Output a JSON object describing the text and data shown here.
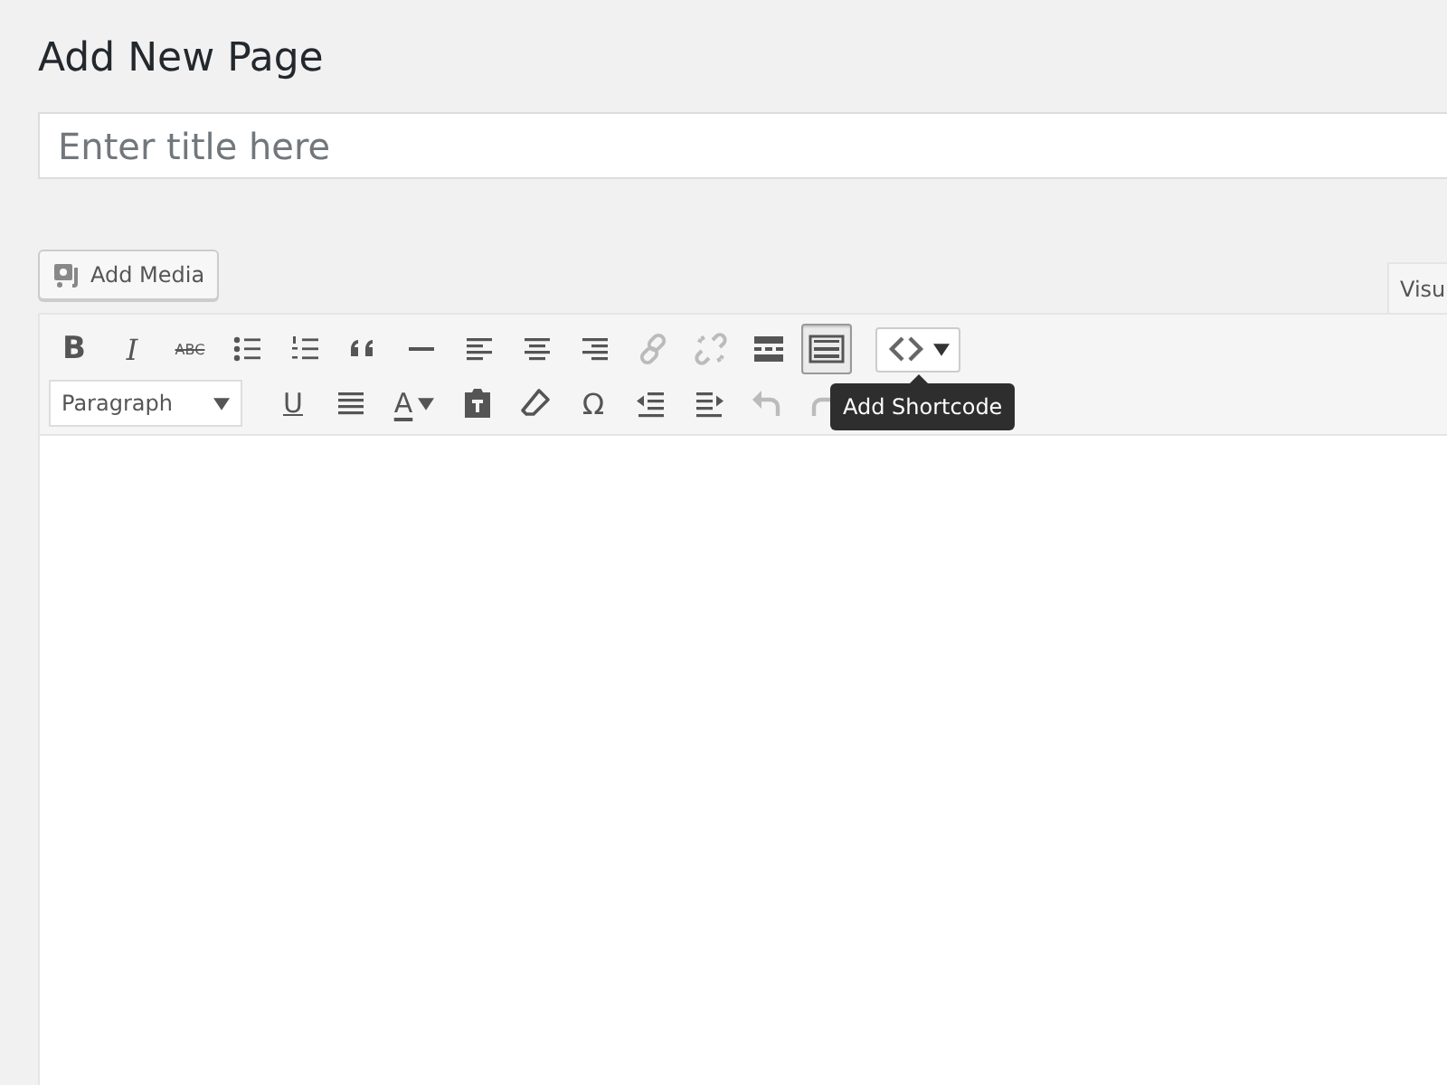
{
  "heading": "Add New Page",
  "title_field": {
    "placeholder": "Enter title here"
  },
  "add_media": {
    "label": "Add Media"
  },
  "editor_tabs": [
    {
      "label": "Visu",
      "selected": true
    }
  ],
  "toolbar_rows": [
    {
      "items": [
        {
          "kind": "bold",
          "text": "B"
        },
        {
          "kind": "italic",
          "text": "I"
        },
        {
          "kind": "strike",
          "text": "ABC"
        },
        {
          "kind": "bullet-list"
        },
        {
          "kind": "numbered-list"
        },
        {
          "kind": "quote"
        },
        {
          "kind": "rule"
        },
        {
          "kind": "align-left"
        },
        {
          "kind": "align-center"
        },
        {
          "kind": "align-right"
        },
        {
          "kind": "link",
          "disabled": true
        },
        {
          "kind": "unlink",
          "disabled": true
        },
        {
          "kind": "more"
        },
        {
          "kind": "keyboard",
          "pressed": true
        },
        {
          "kind": "shortcode",
          "tooltip": "Add Shortcode"
        }
      ]
    },
    {
      "items": [
        {
          "kind": "select",
          "text": "Paragraph"
        },
        {
          "kind": "underline",
          "text": "U"
        },
        {
          "kind": "justify"
        },
        {
          "kind": "color",
          "text": "A"
        },
        {
          "kind": "paste"
        },
        {
          "kind": "eraser"
        },
        {
          "kind": "symbol",
          "text": "Ω"
        },
        {
          "kind": "outdent"
        },
        {
          "kind": "indent"
        },
        {
          "kind": "undo",
          "disabled": true
        },
        {
          "kind": "redo",
          "disabled": true
        }
      ]
    }
  ]
}
